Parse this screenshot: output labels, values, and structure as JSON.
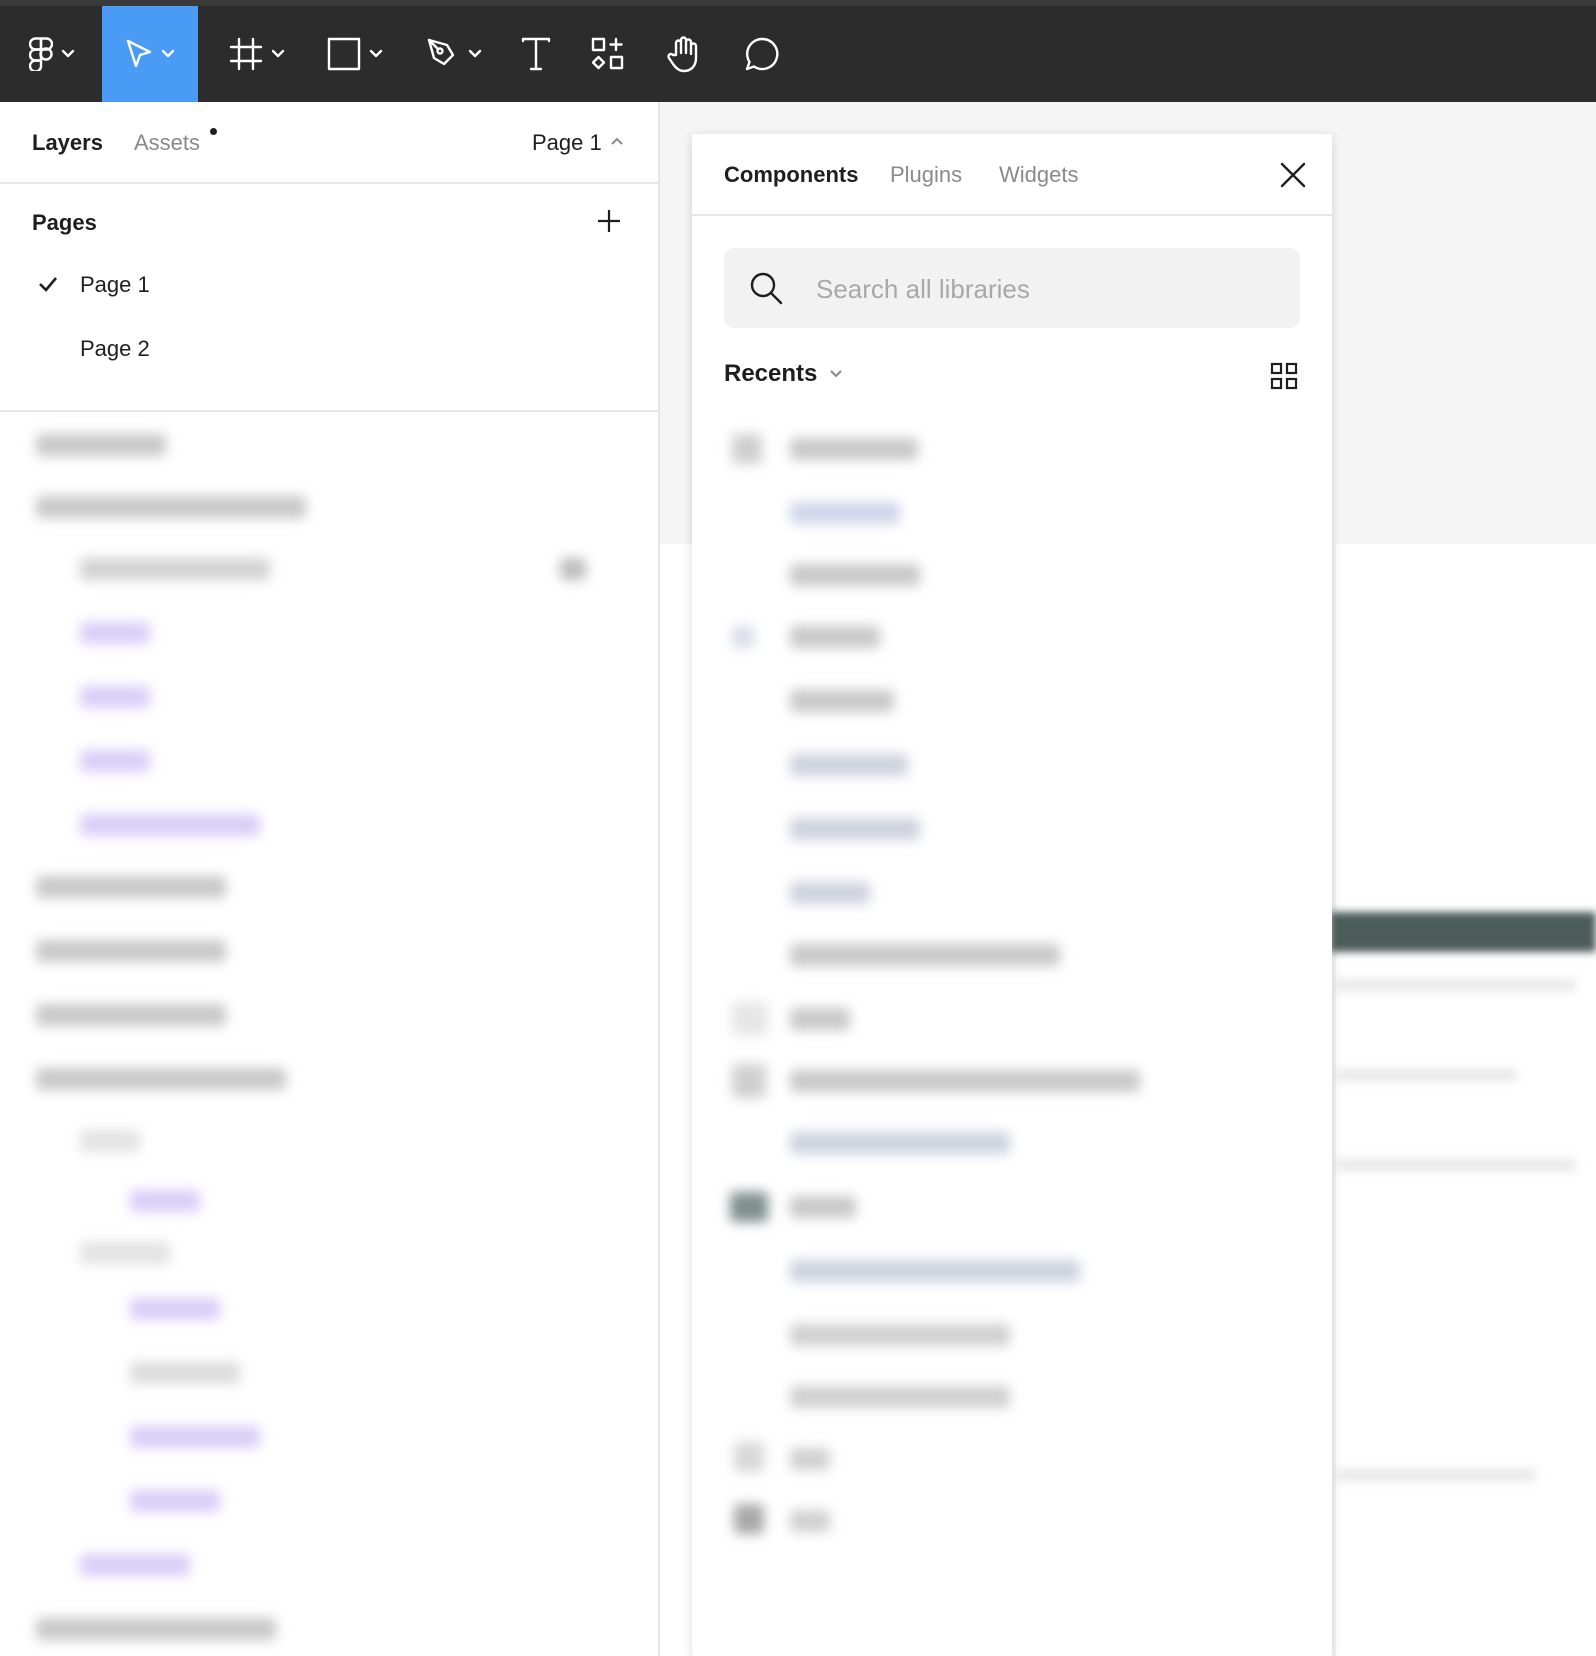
{
  "toolbar": {
    "tools": [
      {
        "icon": "figma-menu-icon"
      },
      {
        "icon": "move-tool-icon",
        "active": true
      },
      {
        "icon": "frame-tool-icon"
      },
      {
        "icon": "rectangle-tool-icon"
      },
      {
        "icon": "pen-tool-icon"
      },
      {
        "icon": "text-tool-icon"
      },
      {
        "icon": "resources-icon"
      },
      {
        "icon": "hand-tool-icon"
      },
      {
        "icon": "comment-tool-icon"
      }
    ],
    "accent": "#4a9bf5"
  },
  "left_panel": {
    "tabs": {
      "layers": "Layers",
      "assets": "Assets"
    },
    "current_page": "Page 1",
    "pages_title": "Pages",
    "pages": [
      {
        "label": "Page 1",
        "selected": true
      },
      {
        "label": "Page 2",
        "selected": false
      }
    ]
  },
  "resources": {
    "tabs": {
      "components": "Components",
      "plugins": "Plugins",
      "widgets": "Widgets"
    },
    "search_placeholder": "Search all libraries",
    "recents_label": "Recents"
  }
}
